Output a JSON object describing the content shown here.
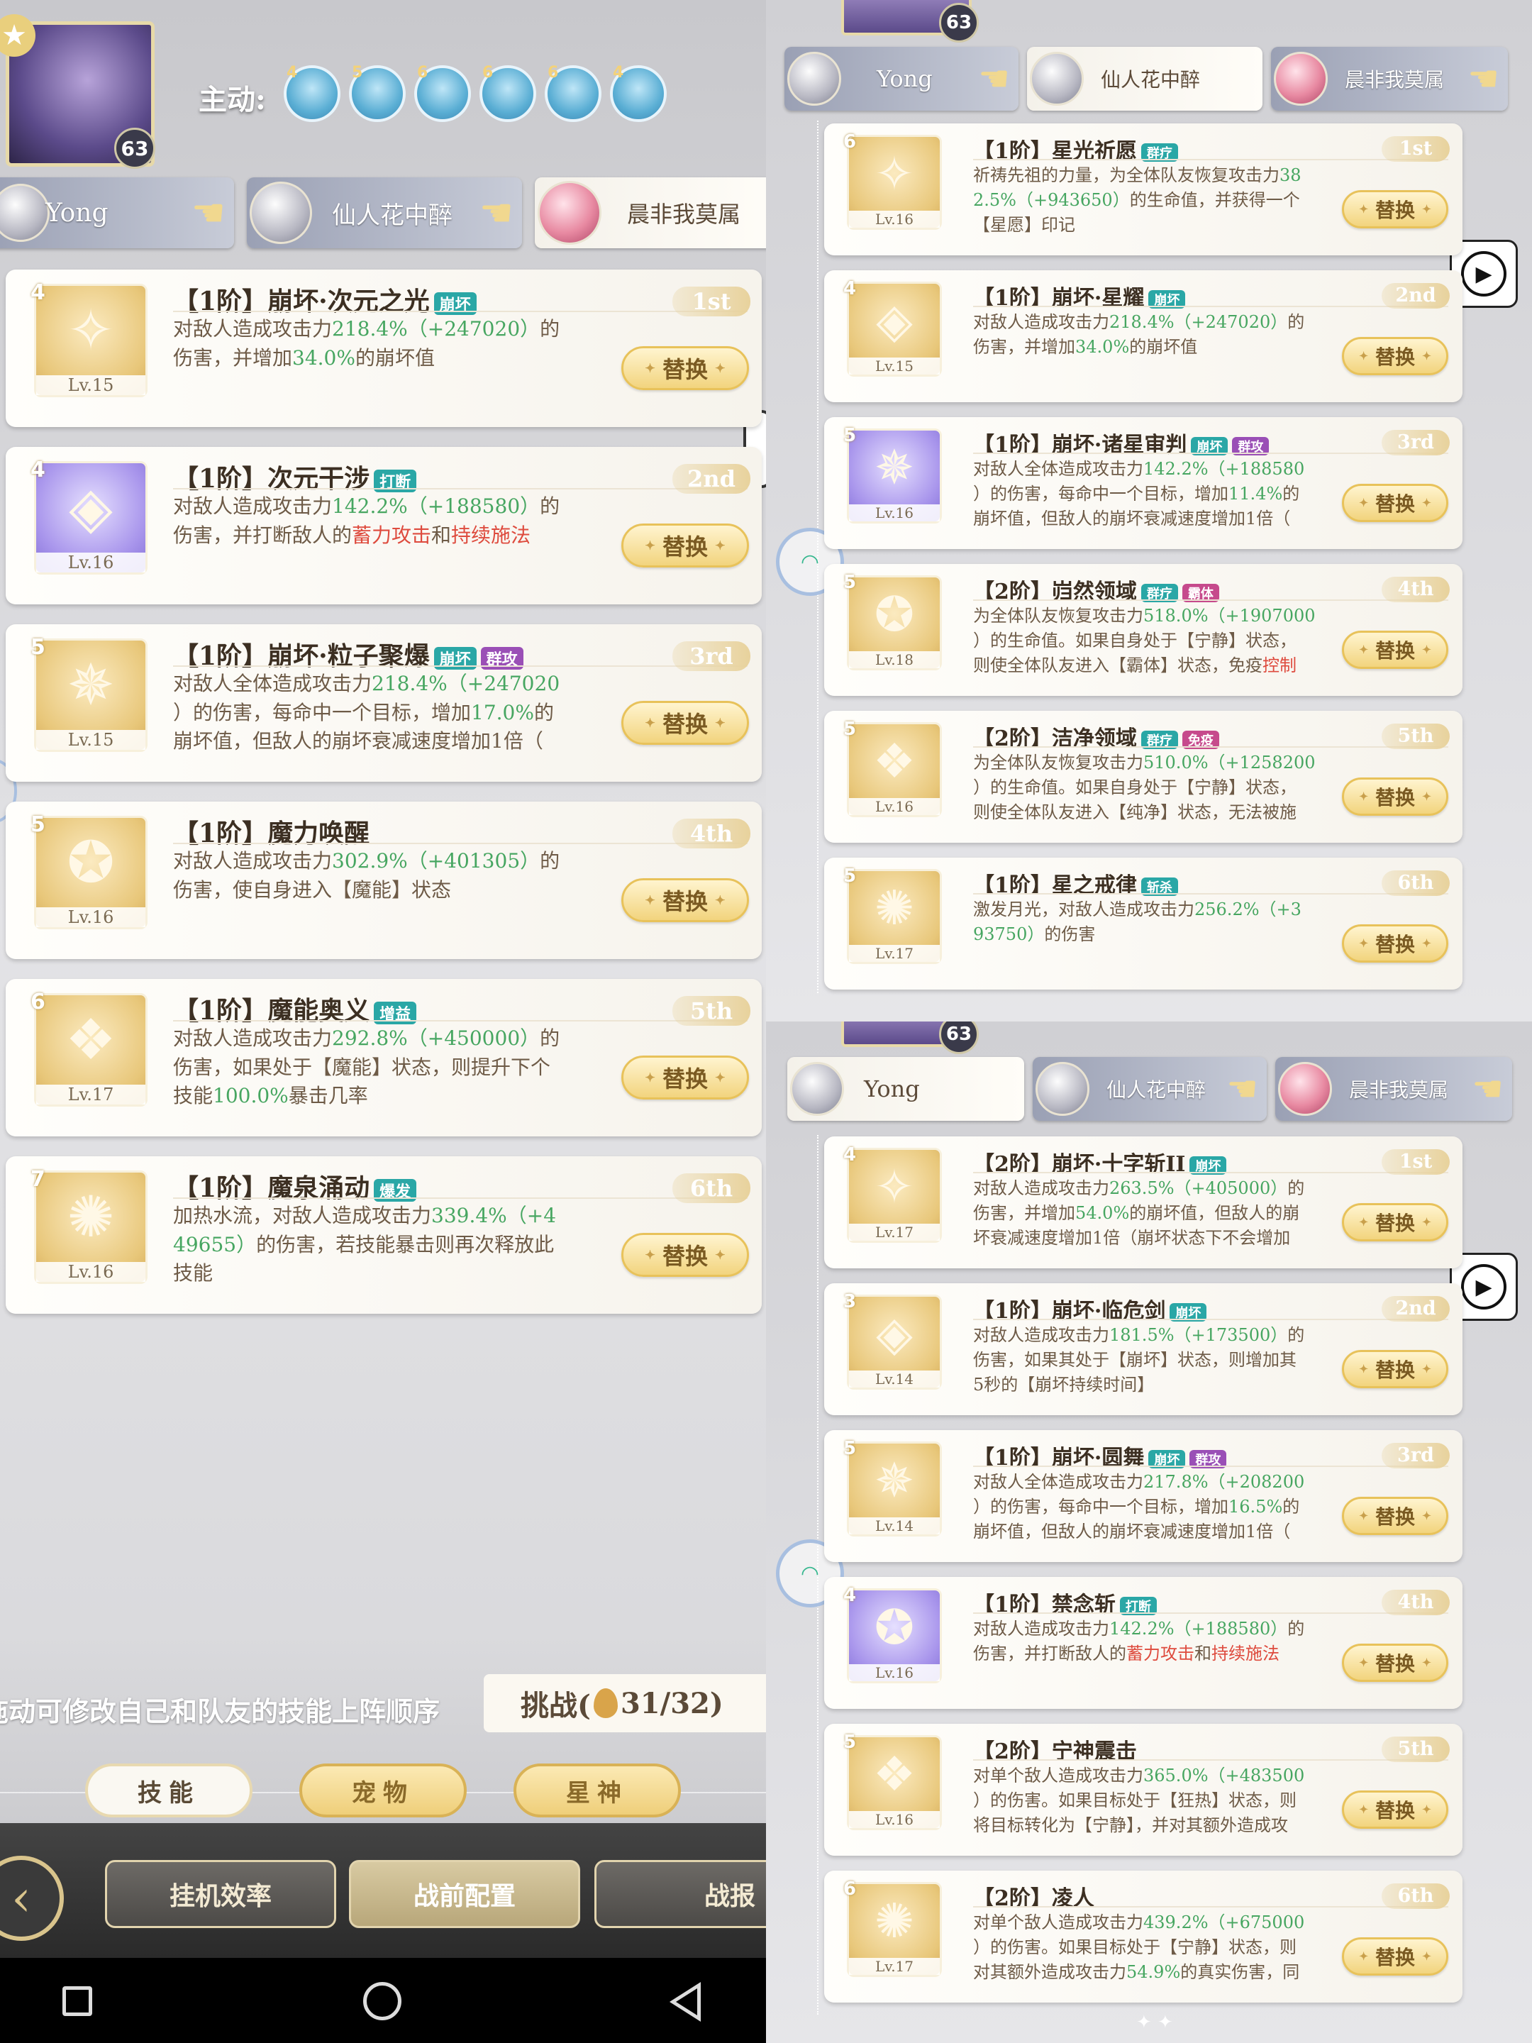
{
  "left": {
    "portrait_level": "63",
    "active_label": "主动:",
    "active_numbers": [
      "4",
      "5",
      "6",
      "6",
      "6",
      "4"
    ],
    "tabs": [
      {
        "name": "Yong"
      },
      {
        "name": "仙人花中醉"
      },
      {
        "name": "晨非我莫属"
      }
    ],
    "skills": [
      {
        "rank": "4",
        "level": "Lv.15",
        "prefix": "【1阶】",
        "name": "崩坏·次元之光",
        "tags": [
          "崩坏"
        ],
        "tag_colors": [
          "teal"
        ],
        "pos": "1st",
        "lines": [
          [
            {
              "t": "对敌人造成攻击力"
            },
            {
              "t": "218.4%（+247020）",
              "c": "g"
            },
            {
              "t": "的"
            }
          ],
          [
            {
              "t": "伤害，并增加"
            },
            {
              "t": "34.0%",
              "c": "g"
            },
            {
              "t": "的崩坏值"
            }
          ]
        ]
      },
      {
        "rank": "4",
        "level": "Lv.16",
        "purple": true,
        "prefix": "【1阶】",
        "name": "次元干涉",
        "tags": [
          "打断"
        ],
        "tag_colors": [
          "teal"
        ],
        "pos": "2nd",
        "lines": [
          [
            {
              "t": "对敌人造成攻击力"
            },
            {
              "t": "142.2%（+188580）",
              "c": "g"
            },
            {
              "t": "的"
            }
          ],
          [
            {
              "t": "伤害，并打断敌人的"
            },
            {
              "t": "蓄力攻击",
              "c": "r"
            },
            {
              "t": "和"
            },
            {
              "t": "持续施法",
              "c": "r"
            }
          ]
        ]
      },
      {
        "rank": "5",
        "level": "Lv.15",
        "prefix": "【1阶】",
        "name": "崩坏·粒子聚爆",
        "tags": [
          "崩坏",
          "群攻"
        ],
        "tag_colors": [
          "teal",
          "purple"
        ],
        "pos": "3rd",
        "lines": [
          [
            {
              "t": "对敌人全体造成攻击力"
            },
            {
              "t": "218.4%（+247020",
              "c": "g"
            }
          ],
          [
            {
              "t": "）的伤害，每命中一个目标，增加"
            },
            {
              "t": "17.0%",
              "c": "g"
            },
            {
              "t": "的"
            }
          ],
          [
            {
              "t": "崩坏值，但敌人的崩坏衰减速度增加1倍（"
            }
          ]
        ]
      },
      {
        "rank": "5",
        "level": "Lv.16",
        "prefix": "【1阶】",
        "name": "魔力唤醒",
        "tags": [],
        "tag_colors": [],
        "pos": "4th",
        "lines": [
          [
            {
              "t": "对敌人造成攻击力"
            },
            {
              "t": "302.9%（+401305）",
              "c": "g"
            },
            {
              "t": "的"
            }
          ],
          [
            {
              "t": "伤害，使自身进入【魔能】状态"
            }
          ]
        ]
      },
      {
        "rank": "6",
        "level": "Lv.17",
        "prefix": "【1阶】",
        "name": "魔能奥义",
        "tags": [
          "增益"
        ],
        "tag_colors": [
          "teal"
        ],
        "pos": "5th",
        "lines": [
          [
            {
              "t": "对敌人造成攻击力"
            },
            {
              "t": "292.8%（+450000）",
              "c": "g"
            },
            {
              "t": "的"
            }
          ],
          [
            {
              "t": "伤害，如果处于【魔能】状态，则提升下个"
            }
          ],
          [
            {
              "t": "技能"
            },
            {
              "t": "100.0%",
              "c": "g"
            },
            {
              "t": "暴击几率"
            }
          ]
        ]
      },
      {
        "rank": "7",
        "level": "Lv.16",
        "prefix": "【1阶】",
        "name": "魔泉涌动",
        "tags": [
          "爆发"
        ],
        "tag_colors": [
          "teal"
        ],
        "pos": "6th",
        "lines": [
          [
            {
              "t": "加热水流，对敌人造成攻击力"
            },
            {
              "t": "339.4%（+4",
              "c": "g"
            }
          ],
          [
            {
              "t": "49655）",
              "c": "g"
            },
            {
              "t": "的伤害，若技能暴击则再次释放此"
            }
          ],
          [
            {
              "t": "技能"
            }
          ]
        ]
      }
    ],
    "swap_label": "替换",
    "hint": "拖动可修改自己和队友的技能上阵顺序",
    "challenge": "挑战(",
    "challenge_count": "31/32)",
    "bottom_tabs": [
      "技能",
      "宠物",
      "星神"
    ],
    "nav": [
      "挂机效率",
      "战前配置",
      "战报"
    ]
  },
  "right_top": {
    "portrait_level": "63",
    "tabs": [
      {
        "name": "Yong"
      },
      {
        "name": "仙人花中醉"
      },
      {
        "name": "晨非我莫属"
      }
    ],
    "skills": [
      {
        "rank": "6",
        "level": "Lv.16",
        "prefix": "【1阶】",
        "name": "星光祈愿",
        "tags": [
          "群疗"
        ],
        "tag_colors": [
          "teal"
        ],
        "pos": "1st",
        "lines": [
          [
            {
              "t": "祈祷先祖的力量，为全体队友恢复攻击力"
            },
            {
              "t": "38",
              "c": "g"
            }
          ],
          [
            {
              "t": "2.5%（+943650）",
              "c": "g"
            },
            {
              "t": "的生命值，并获得一个"
            }
          ],
          [
            {
              "t": "【星愿】印记"
            }
          ]
        ]
      },
      {
        "rank": "4",
        "level": "Lv.15",
        "prefix": "【1阶】",
        "name": "崩坏·星耀",
        "tags": [
          "崩坏"
        ],
        "tag_colors": [
          "teal"
        ],
        "pos": "2nd",
        "lines": [
          [
            {
              "t": "对敌人造成攻击力"
            },
            {
              "t": "218.4%（+247020）",
              "c": "g"
            },
            {
              "t": "的"
            }
          ],
          [
            {
              "t": "伤害，并增加"
            },
            {
              "t": "34.0%",
              "c": "g"
            },
            {
              "t": "的崩坏值"
            }
          ]
        ]
      },
      {
        "rank": "5",
        "level": "Lv.16",
        "purple": true,
        "prefix": "【1阶】",
        "name": "崩坏·诸星审判",
        "tags": [
          "崩坏",
          "群攻"
        ],
        "tag_colors": [
          "teal",
          "purple"
        ],
        "pos": "3rd",
        "lines": [
          [
            {
              "t": "对敌人全体造成攻击力"
            },
            {
              "t": "142.2%（+188580",
              "c": "g"
            }
          ],
          [
            {
              "t": "）的伤害，每命中一个目标，增加"
            },
            {
              "t": "11.4%",
              "c": "g"
            },
            {
              "t": "的"
            }
          ],
          [
            {
              "t": "崩坏值，但敌人的崩坏衰减速度增加1倍（"
            }
          ]
        ]
      },
      {
        "rank": "5",
        "level": "Lv.18",
        "prefix": "【2阶】",
        "name": "岿然领域",
        "tags": [
          "群疗",
          "霸体"
        ],
        "tag_colors": [
          "teal",
          "magenta"
        ],
        "pos": "4th",
        "lines": [
          [
            {
              "t": "为全体队友恢复攻击力"
            },
            {
              "t": "518.0%（+1907000",
              "c": "g"
            }
          ],
          [
            {
              "t": "）的生命值。如果自身处于【宁静】状态，"
            }
          ],
          [
            {
              "t": "则使全体队友进入【霸体】状态，免疫"
            },
            {
              "t": "控制",
              "c": "r"
            }
          ]
        ]
      },
      {
        "rank": "5",
        "level": "Lv.16",
        "prefix": "【2阶】",
        "name": "洁净领域",
        "tags": [
          "群疗",
          "免疫"
        ],
        "tag_colors": [
          "teal",
          "magenta"
        ],
        "pos": "5th",
        "lines": [
          [
            {
              "t": "为全体队友恢复攻击力"
            },
            {
              "t": "510.0%（+1258200",
              "c": "g"
            }
          ],
          [
            {
              "t": "）的生命值。如果自身处于【宁静】状态，"
            }
          ],
          [
            {
              "t": "则使全体队友进入【纯净】状态，无法被施"
            }
          ]
        ]
      },
      {
        "rank": "5",
        "level": "Lv.17",
        "prefix": "【1阶】",
        "name": "星之戒律",
        "tags": [
          "斩杀"
        ],
        "tag_colors": [
          "teal"
        ],
        "pos": "6th",
        "lines": [
          [
            {
              "t": "激发月光，对敌人造成攻击力"
            },
            {
              "t": "256.2%（+3",
              "c": "g"
            }
          ],
          [
            {
              "t": "93750）",
              "c": "g"
            },
            {
              "t": "的伤害"
            }
          ]
        ]
      }
    ]
  },
  "right_bottom": {
    "portrait_level": "63",
    "tabs": [
      {
        "name": "Yong"
      },
      {
        "name": "仙人花中醉"
      },
      {
        "name": "晨非我莫属"
      }
    ],
    "skills": [
      {
        "rank": "4",
        "level": "Lv.17",
        "prefix": "【2阶】",
        "name": "崩坏·十字斩II",
        "tags": [
          "崩坏"
        ],
        "tag_colors": [
          "teal"
        ],
        "pos": "1st",
        "lines": [
          [
            {
              "t": "对敌人造成攻击力"
            },
            {
              "t": "263.5%（+405000）",
              "c": "g"
            },
            {
              "t": "的"
            }
          ],
          [
            {
              "t": "伤害，并增加"
            },
            {
              "t": "54.0%",
              "c": "g"
            },
            {
              "t": "的崩坏值，但敌人的崩"
            }
          ],
          [
            {
              "t": "坏衰减速度增加1倍（崩坏状态下不会增加"
            }
          ]
        ]
      },
      {
        "rank": "3",
        "level": "Lv.14",
        "prefix": "【1阶】",
        "name": "崩坏·临危剑",
        "tags": [
          "崩坏"
        ],
        "tag_colors": [
          "teal"
        ],
        "pos": "2nd",
        "lines": [
          [
            {
              "t": "对敌人造成攻击力"
            },
            {
              "t": "181.5%（+173500）",
              "c": "g"
            },
            {
              "t": "的"
            }
          ],
          [
            {
              "t": "伤害，如果其处于【崩坏】状态，则增加其"
            }
          ],
          [
            {
              "t": "5秒的【崩坏持续时间】"
            }
          ]
        ]
      },
      {
        "rank": "5",
        "level": "Lv.14",
        "prefix": "【1阶】",
        "name": "崩坏·圆舞",
        "tags": [
          "崩坏",
          "群攻"
        ],
        "tag_colors": [
          "teal",
          "purple"
        ],
        "pos": "3rd",
        "lines": [
          [
            {
              "t": "对敌人全体造成攻击力"
            },
            {
              "t": "217.8%（+208200",
              "c": "g"
            }
          ],
          [
            {
              "t": "）的伤害，每命中一个目标，增加"
            },
            {
              "t": "16.5%",
              "c": "g"
            },
            {
              "t": "的"
            }
          ],
          [
            {
              "t": "崩坏值，但敌人的崩坏衰减速度增加1倍（"
            }
          ]
        ]
      },
      {
        "rank": "4",
        "level": "Lv.16",
        "purple": true,
        "prefix": "【1阶】",
        "name": "禁念斩",
        "tags": [
          "打断"
        ],
        "tag_colors": [
          "teal"
        ],
        "pos": "4th",
        "lines": [
          [
            {
              "t": "对敌人造成攻击力"
            },
            {
              "t": "142.2%（+188580）",
              "c": "g"
            },
            {
              "t": "的"
            }
          ],
          [
            {
              "t": "伤害，并打断敌人的"
            },
            {
              "t": "蓄力攻击",
              "c": "r"
            },
            {
              "t": "和"
            },
            {
              "t": "持续施法",
              "c": "r"
            }
          ]
        ]
      },
      {
        "rank": "5",
        "level": "Lv.16",
        "prefix": "【2阶】",
        "name": "宁神震击",
        "tags": [],
        "tag_colors": [],
        "pos": "5th",
        "lines": [
          [
            {
              "t": "对单个敌人造成攻击力"
            },
            {
              "t": "365.0%（+483500",
              "c": "g"
            }
          ],
          [
            {
              "t": "）的伤害。如果目标处于【狂热】状态，则"
            }
          ],
          [
            {
              "t": "将目标转化为【宁静】，并对其额外造成攻"
            }
          ]
        ]
      },
      {
        "rank": "6",
        "level": "Lv.17",
        "prefix": "【2阶】",
        "name": "凌人",
        "tags": [],
        "tag_colors": [],
        "pos": "6th",
        "lines": [
          [
            {
              "t": "对单个敌人造成攻击力"
            },
            {
              "t": "439.2%（+675000",
              "c": "g"
            }
          ],
          [
            {
              "t": "）的伤害。如果目标处于【宁静】状态，则"
            }
          ],
          [
            {
              "t": "对其额外造成攻击力"
            },
            {
              "t": "54.9%",
              "c": "g"
            },
            {
              "t": "的真实伤害，同"
            }
          ]
        ]
      }
    ]
  }
}
